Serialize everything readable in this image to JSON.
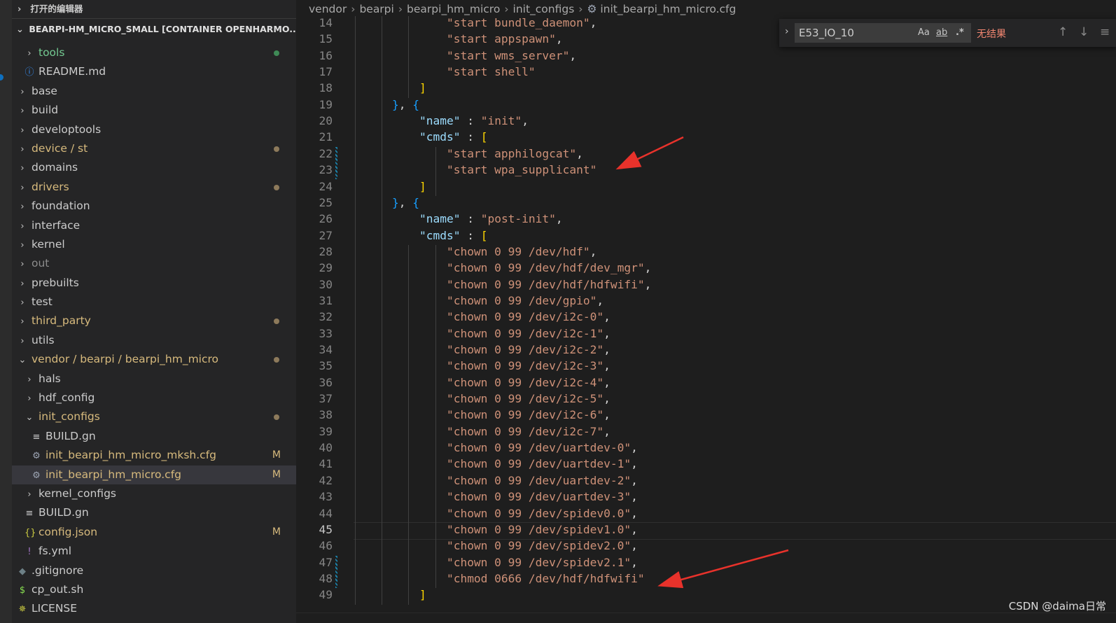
{
  "sidebar": {
    "open_editors_label": "打开的编辑器",
    "workspace_label": "BEARPI-HM_MICRO_SMALL [CONTAINER OPENHARMO...",
    "items": [
      {
        "label": "tools",
        "color": "#73c991",
        "icon": "chevron-right",
        "indent": 2,
        "dot": "#3f8a56"
      },
      {
        "label": "README.md",
        "color": "#cccccc",
        "icon": "info",
        "indent": 2
      },
      {
        "label": "base",
        "color": "#cccccc",
        "icon": "chevron-right",
        "indent": 1
      },
      {
        "label": "build",
        "color": "#cccccc",
        "icon": "chevron-right",
        "indent": 1
      },
      {
        "label": "developtools",
        "color": "#cccccc",
        "icon": "chevron-right",
        "indent": 1
      },
      {
        "label": "device / st",
        "color": "#d7ba7d",
        "icon": "chevron-right",
        "indent": 1,
        "dot": "#8d7a5b"
      },
      {
        "label": "domains",
        "color": "#cccccc",
        "icon": "chevron-right",
        "indent": 1
      },
      {
        "label": "drivers",
        "color": "#d7ba7d",
        "icon": "chevron-right",
        "indent": 1,
        "dot": "#8d7a5b"
      },
      {
        "label": "foundation",
        "color": "#cccccc",
        "icon": "chevron-right",
        "indent": 1
      },
      {
        "label": "interface",
        "color": "#cccccc",
        "icon": "chevron-right",
        "indent": 1
      },
      {
        "label": "kernel",
        "color": "#cccccc",
        "icon": "chevron-right",
        "indent": 1
      },
      {
        "label": "out",
        "color": "#8c8c8c",
        "icon": "chevron-right",
        "indent": 1
      },
      {
        "label": "prebuilts",
        "color": "#cccccc",
        "icon": "chevron-right",
        "indent": 1
      },
      {
        "label": "test",
        "color": "#cccccc",
        "icon": "chevron-right",
        "indent": 1
      },
      {
        "label": "third_party",
        "color": "#d7ba7d",
        "icon": "chevron-right",
        "indent": 1,
        "dot": "#8d7a5b"
      },
      {
        "label": "utils",
        "color": "#cccccc",
        "icon": "chevron-right",
        "indent": 1
      },
      {
        "label": "vendor / bearpi / bearpi_hm_micro",
        "color": "#d7ba7d",
        "icon": "chevron-down",
        "indent": 1,
        "dot": "#8d7a5b"
      },
      {
        "label": "hals",
        "color": "#cccccc",
        "icon": "chevron-right",
        "indent": 2
      },
      {
        "label": "hdf_config",
        "color": "#cccccc",
        "icon": "chevron-right",
        "indent": 2
      },
      {
        "label": "init_configs",
        "color": "#d7ba7d",
        "icon": "chevron-down",
        "indent": 2,
        "dot": "#8d7a5b"
      },
      {
        "label": "BUILD.gn",
        "color": "#cccccc",
        "icon": "lines",
        "indent": 3
      },
      {
        "label": "init_bearpi_hm_micro_mksh.cfg",
        "color": "#d7ba7d",
        "icon": "gear",
        "indent": 3,
        "badge": "M"
      },
      {
        "label": "init_bearpi_hm_micro.cfg",
        "color": "#d7ba7d",
        "icon": "gear",
        "indent": 3,
        "badge": "M",
        "selected": true
      },
      {
        "label": "kernel_configs",
        "color": "#cccccc",
        "icon": "chevron-right",
        "indent": 2
      },
      {
        "label": "BUILD.gn",
        "color": "#cccccc",
        "icon": "lines",
        "indent": 2
      },
      {
        "label": "config.json",
        "color": "#d7ba7d",
        "icon": "braces",
        "indent": 2,
        "badge": "M"
      },
      {
        "label": "fs.yml",
        "color": "#cccccc",
        "icon": "exclaim",
        "indent": 2
      },
      {
        "label": ".gitignore",
        "color": "#cccccc",
        "icon": "git",
        "indent": 1
      },
      {
        "label": "cp_out.sh",
        "color": "#cccccc",
        "icon": "dollar",
        "indent": 1
      },
      {
        "label": "LICENSE",
        "color": "#cccccc",
        "icon": "ribbon",
        "indent": 1
      }
    ]
  },
  "breadcrumbs": [
    "vendor",
    "bearpi",
    "bearpi_hm_micro",
    "init_configs",
    "init_bearpi_hm_micro.cfg"
  ],
  "find": {
    "query": "E53_IO_10",
    "opt_case": "Aa",
    "opt_word": "ab",
    "opt_regex": ".*",
    "result": "无结果"
  },
  "code": {
    "current_line": 45,
    "lines": [
      {
        "n": 14,
        "t": "            \"start bundle_daemon\","
      },
      {
        "n": 15,
        "t": "            \"start appspawn\","
      },
      {
        "n": 16,
        "t": "            \"start wms_server\","
      },
      {
        "n": 17,
        "t": "            \"start shell\""
      },
      {
        "n": 18,
        "t": "        ]"
      },
      {
        "n": 19,
        "t": "    }, {"
      },
      {
        "n": 20,
        "t": "        \"name\" : \"init\","
      },
      {
        "n": 21,
        "t": "        \"cmds\" : ["
      },
      {
        "n": 22,
        "t": "            \"start apphilogcat\","
      },
      {
        "n": 23,
        "t": "            \"start wpa_supplicant\""
      },
      {
        "n": 24,
        "t": "        ]"
      },
      {
        "n": 25,
        "t": "    }, {"
      },
      {
        "n": 26,
        "t": "        \"name\" : \"post-init\","
      },
      {
        "n": 27,
        "t": "        \"cmds\" : ["
      },
      {
        "n": 28,
        "t": "            \"chown 0 99 /dev/hdf\","
      },
      {
        "n": 29,
        "t": "            \"chown 0 99 /dev/hdf/dev_mgr\","
      },
      {
        "n": 30,
        "t": "            \"chown 0 99 /dev/hdf/hdfwifi\","
      },
      {
        "n": 31,
        "t": "            \"chown 0 99 /dev/gpio\","
      },
      {
        "n": 32,
        "t": "            \"chown 0 99 /dev/i2c-0\","
      },
      {
        "n": 33,
        "t": "            \"chown 0 99 /dev/i2c-1\","
      },
      {
        "n": 34,
        "t": "            \"chown 0 99 /dev/i2c-2\","
      },
      {
        "n": 35,
        "t": "            \"chown 0 99 /dev/i2c-3\","
      },
      {
        "n": 36,
        "t": "            \"chown 0 99 /dev/i2c-4\","
      },
      {
        "n": 37,
        "t": "            \"chown 0 99 /dev/i2c-5\","
      },
      {
        "n": 38,
        "t": "            \"chown 0 99 /dev/i2c-6\","
      },
      {
        "n": 39,
        "t": "            \"chown 0 99 /dev/i2c-7\","
      },
      {
        "n": 40,
        "t": "            \"chown 0 99 /dev/uartdev-0\","
      },
      {
        "n": 41,
        "t": "            \"chown 0 99 /dev/uartdev-1\","
      },
      {
        "n": 42,
        "t": "            \"chown 0 99 /dev/uartdev-2\","
      },
      {
        "n": 43,
        "t": "            \"chown 0 99 /dev/uartdev-3\","
      },
      {
        "n": 44,
        "t": "            \"chown 0 99 /dev/spidev0.0\","
      },
      {
        "n": 45,
        "t": "            \"chown 0 99 /dev/spidev1.0\","
      },
      {
        "n": 46,
        "t": "            \"chown 0 99 /dev/spidev2.0\","
      },
      {
        "n": 47,
        "t": "            \"chown 0 99 /dev/spidev2.1\","
      },
      {
        "n": 48,
        "t": "            \"chmod 0666 /dev/hdf/hdfwifi\""
      },
      {
        "n": 49,
        "t": "        ]"
      }
    ]
  },
  "watermark": "CSDN @daima日常",
  "colors": {
    "string": "#ce9178",
    "key": "#9cdcfe",
    "bracket1": "#ffd700",
    "bracket2": "#179fff",
    "annotation_arrow": "#e8322b"
  }
}
